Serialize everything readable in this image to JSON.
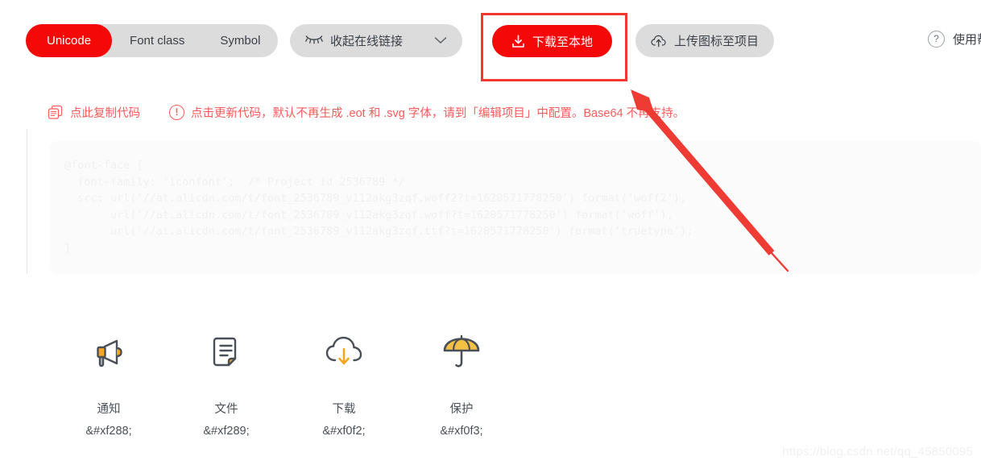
{
  "toolbar": {
    "segmented": {
      "items": [
        {
          "label": "Unicode",
          "active": true
        },
        {
          "label": "Font class",
          "active": false
        },
        {
          "label": "Symbol",
          "active": false
        }
      ]
    },
    "collapse_links": {
      "icon": "eye-closed-icon",
      "label": "收起在线链接",
      "chevron": "chevron-down-icon"
    },
    "download_button": {
      "icon": "download-icon",
      "label": "下载至本地",
      "color": "#f50808"
    },
    "upload_button": {
      "icon": "cloud-upload-icon",
      "label": "上传图标至项目"
    },
    "help": {
      "icon": "question-circle-icon",
      "label": "使用帮"
    }
  },
  "notice": {
    "copy_icon": "copy-icon",
    "copy_label": "点此复制代码",
    "warning_icon": "exclamation-circle-icon",
    "message": "点击更新代码，默认不再生成 .eot 和 .svg 字体，请到「编辑项目」中配置。Base64 不再支持。",
    "color": "#fb5b5b"
  },
  "code_panel": {
    "content": "@font-face {\n  font-family: 'iconfont';  /* Project id 2536789 */\n  src: url('//at.alicdn.com/t/font_2536789_v112akg3zqf.woff2?t=1620571778250') format('woff2'),\n       url('//at.alicdn.com/t/font_2536789_v112akg3zqf.woff?t=1620571778250') format('woff'),\n       url('//at.alicdn.com/t/font_2536789_v112akg3zqf.ttf?t=1620571778250') format('truetype');\n}"
  },
  "icon_grid": {
    "items": [
      {
        "icon": "megaphone-icon",
        "name": "通知",
        "code": "&#xf288;"
      },
      {
        "icon": "document-icon",
        "name": "文件",
        "code": "&#xf289;"
      },
      {
        "icon": "cloud-download-icon",
        "name": "下载",
        "code": "&#xf0f2;"
      },
      {
        "icon": "umbrella-icon",
        "name": "保护",
        "code": "&#xf0f3;"
      }
    ],
    "icon_colors": {
      "accent": "#f5a623",
      "outline": "#4a5058"
    }
  },
  "annotation": {
    "highlight_color": "#f2372f",
    "arrow_color": "#ee3b34"
  },
  "watermark": {
    "text": "https://blog.csdn.net/qq_45850095"
  }
}
